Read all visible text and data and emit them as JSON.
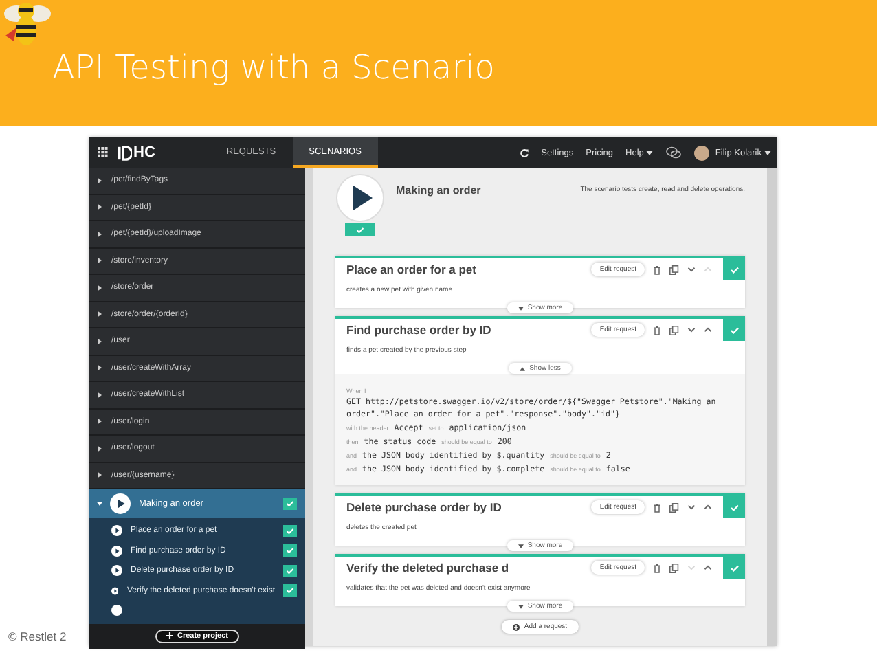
{
  "slide": {
    "title": "API Testing with a Scenario",
    "footer": "© Restlet 2"
  },
  "nav": {
    "logo": "HC",
    "tabs": [
      {
        "label": "REQUESTS",
        "selected": false
      },
      {
        "label": "SCENARIOS",
        "selected": true
      }
    ],
    "links": [
      {
        "label": "Settings",
        "has_menu": false
      },
      {
        "label": "Pricing",
        "has_menu": false
      },
      {
        "label": "Help",
        "has_menu": true
      }
    ],
    "user": "Filip Kolarik"
  },
  "sidebar": {
    "items": [
      {
        "label": "/pet/findByTags",
        "expanded": false
      },
      {
        "label": "/pet/{petId}",
        "expanded": false
      },
      {
        "label": "/pet/{petId}/uploadImage",
        "expanded": false
      },
      {
        "label": "/store/inventory",
        "expanded": false
      },
      {
        "label": "/store/order",
        "expanded": false
      },
      {
        "label": "/store/order/{orderId}",
        "expanded": false
      },
      {
        "label": "/user",
        "expanded": false
      },
      {
        "label": "/user/createWithArray",
        "expanded": false
      },
      {
        "label": "/user/createWithList",
        "expanded": false
      },
      {
        "label": "/user/login",
        "expanded": false
      },
      {
        "label": "/user/logout",
        "expanded": false
      },
      {
        "label": "/user/{username}",
        "expanded": false
      }
    ],
    "scenario": {
      "label": "Making an order",
      "expanded": true,
      "selected": true,
      "passed": true,
      "steps": [
        {
          "label": "Place an order for a pet",
          "passed": true
        },
        {
          "label": "Find purchase order by ID",
          "passed": true
        },
        {
          "label": "Delete purchase order by ID",
          "passed": true
        },
        {
          "label": "Verify the deleted purchase doesn't exist",
          "passed": true
        }
      ]
    },
    "create_button": "Create project"
  },
  "scenario": {
    "title": "Making an order",
    "description": "The scenario tests create, read and delete operations.",
    "passed": true
  },
  "requests": [
    {
      "title": "Place an order for a pet",
      "description": "creates a new pet with given name",
      "edit_button": "Edit request",
      "toggle": "Show more",
      "expanded": false,
      "passed": true,
      "up_disabled": true,
      "down_disabled": false
    },
    {
      "title": "Find purchase order by ID",
      "description": "finds a pet created by the previous step",
      "edit_button": "Edit request",
      "toggle": "Show less",
      "expanded": true,
      "passed": true,
      "up_disabled": false,
      "down_disabled": false,
      "details": [
        [
          {
            "kind": "keyword",
            "text": "When I"
          },
          {
            "kind": "code",
            "text": "GET  http://petstore.swagger.io/v2/store/order/${\"Swagger Petstore\".\"Making an order\".\"Place an order for a pet\".\"response\".\"body\".\"id\"}"
          }
        ],
        [
          {
            "kind": "keyword",
            "text": "with the header"
          },
          {
            "kind": "code",
            "text": "Accept"
          },
          {
            "kind": "keyword",
            "text": "set to"
          },
          {
            "kind": "code",
            "text": "application/json"
          }
        ],
        [
          {
            "kind": "keyword",
            "text": "then"
          },
          {
            "kind": "code",
            "text": "the status code"
          },
          {
            "kind": "keyword",
            "text": "should be equal to"
          },
          {
            "kind": "code",
            "text": "200"
          }
        ],
        [
          {
            "kind": "keyword",
            "text": "and"
          },
          {
            "kind": "code",
            "text": "the JSON body identified by $.quantity"
          },
          {
            "kind": "keyword",
            "text": "should be equal to"
          },
          {
            "kind": "code",
            "text": "2"
          }
        ],
        [
          {
            "kind": "keyword",
            "text": "and"
          },
          {
            "kind": "code",
            "text": "the JSON body identified by $.complete"
          },
          {
            "kind": "keyword",
            "text": "should be equal to"
          },
          {
            "kind": "code",
            "text": "false"
          }
        ]
      ]
    },
    {
      "title": "Delete purchase order by ID",
      "description": "deletes the created pet",
      "edit_button": "Edit request",
      "toggle": "Show more",
      "expanded": false,
      "passed": true,
      "up_disabled": false,
      "down_disabled": false
    },
    {
      "title": "Verify the deleted purchase d",
      "description": "validates that the pet was deleted and doesn't exist anymore",
      "edit_button": "Edit request",
      "toggle": "Show more",
      "expanded": false,
      "passed": true,
      "up_disabled": false,
      "down_disabled": true
    }
  ],
  "add_button": "Add a request"
}
